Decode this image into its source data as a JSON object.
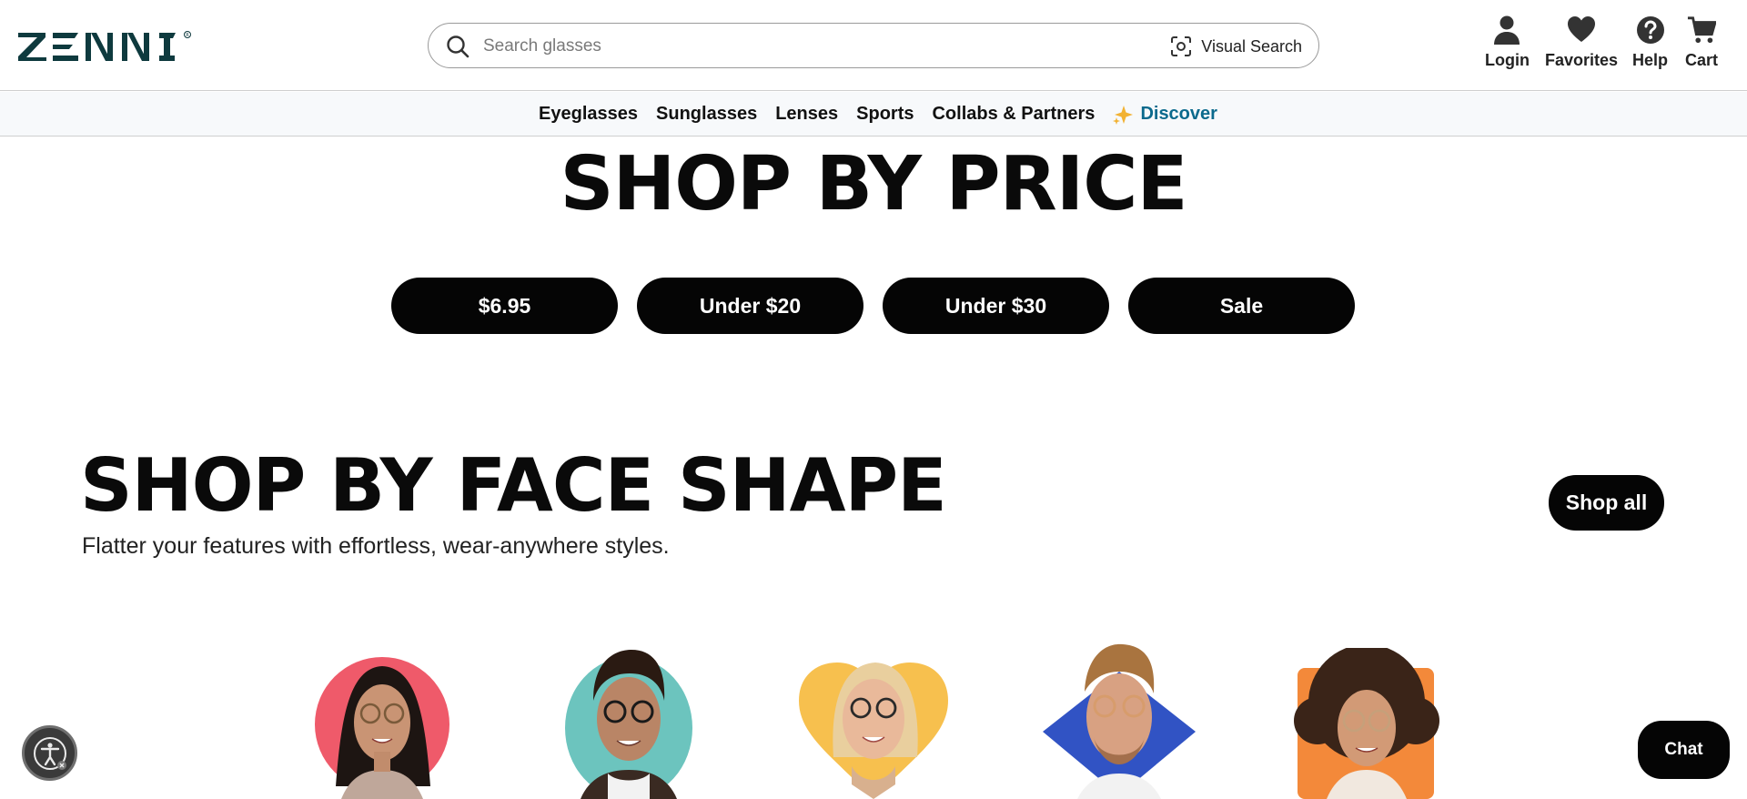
{
  "header": {
    "logo_text": "ZENNI",
    "search": {
      "placeholder": "Search glasses",
      "value": "",
      "visual_search_label": "Visual Search"
    },
    "utility": [
      {
        "key": "login",
        "label": "Login",
        "icon": "person-icon"
      },
      {
        "key": "favorites",
        "label": "Favorites",
        "icon": "heart-icon"
      },
      {
        "key": "help",
        "label": "Help",
        "icon": "help-icon"
      },
      {
        "key": "cart",
        "label": "Cart",
        "icon": "cart-icon"
      }
    ]
  },
  "nav": {
    "items": [
      "Eyeglasses",
      "Sunglasses",
      "Lenses",
      "Sports",
      "Collabs & Partners"
    ],
    "discover_label": "Discover",
    "discover_color": "#0b6a8d"
  },
  "shop_by_price": {
    "title": "SHOP BY PRICE",
    "buttons": [
      "$6.95",
      "Under $20",
      "Under $30",
      "Sale"
    ]
  },
  "shop_by_face": {
    "title": "SHOP BY FACE SHAPE",
    "subtitle": "Flatter your features with effortless, wear-anywhere styles.",
    "shop_all_label": "Shop all",
    "faces": [
      {
        "shape": "round",
        "accent": "#ef5a6a"
      },
      {
        "shape": "oval",
        "accent": "#6cc4be"
      },
      {
        "shape": "heart",
        "accent": "#f7c04e"
      },
      {
        "shape": "diamond",
        "accent": "#3153c4"
      },
      {
        "shape": "square",
        "accent": "#f3893a"
      }
    ]
  },
  "floating": {
    "chat_label": "Chat",
    "accessibility_icon": "accessibility-icon"
  }
}
